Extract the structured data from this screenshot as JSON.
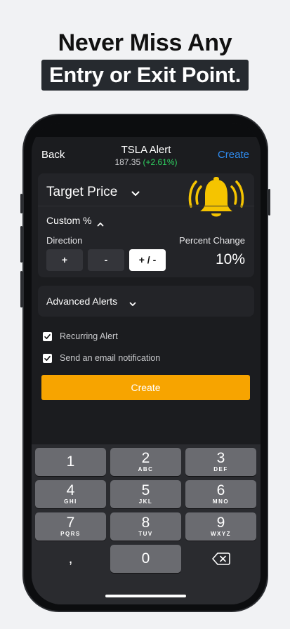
{
  "promo": {
    "line1": "Never Miss Any",
    "line2": "Entry or Exit Point."
  },
  "nav": {
    "back": "Back",
    "title": "TSLA Alert",
    "price": "187.35",
    "change": "(+2.61%)",
    "create": "Create"
  },
  "alert": {
    "target_label": "Target Price",
    "custom_label": "Custom %",
    "direction_label": "Direction",
    "percent_label": "Percent Change",
    "percent_value": "10%",
    "directions": [
      {
        "label": "+"
      },
      {
        "label": "-"
      },
      {
        "label": "+ / -",
        "selected": true
      }
    ]
  },
  "advanced": {
    "label": "Advanced Alerts"
  },
  "options": {
    "recurring": {
      "label": "Recurring Alert",
      "checked": true
    },
    "email": {
      "label": "Send an email notification",
      "checked": true
    }
  },
  "create_button": "Create",
  "keypad": {
    "keys": [
      {
        "num": "1",
        "letters": ""
      },
      {
        "num": "2",
        "letters": "ABC"
      },
      {
        "num": "3",
        "letters": "DEF"
      },
      {
        "num": "4",
        "letters": "GHI"
      },
      {
        "num": "5",
        "letters": "JKL"
      },
      {
        "num": "6",
        "letters": "MNO"
      },
      {
        "num": "7",
        "letters": "PQRS"
      },
      {
        "num": "8",
        "letters": "TUV"
      },
      {
        "num": "9",
        "letters": "WXYZ"
      }
    ],
    "comma": ",",
    "zero": "0"
  },
  "colors": {
    "accent_orange": "#f7a400",
    "link_blue": "#2f8cf0",
    "positive_green": "#2fd060",
    "bell_yellow": "#f5c400"
  },
  "icons": [
    "bell-icon",
    "chevron-down-icon",
    "chevron-up-icon",
    "check-icon",
    "backspace-icon"
  ]
}
